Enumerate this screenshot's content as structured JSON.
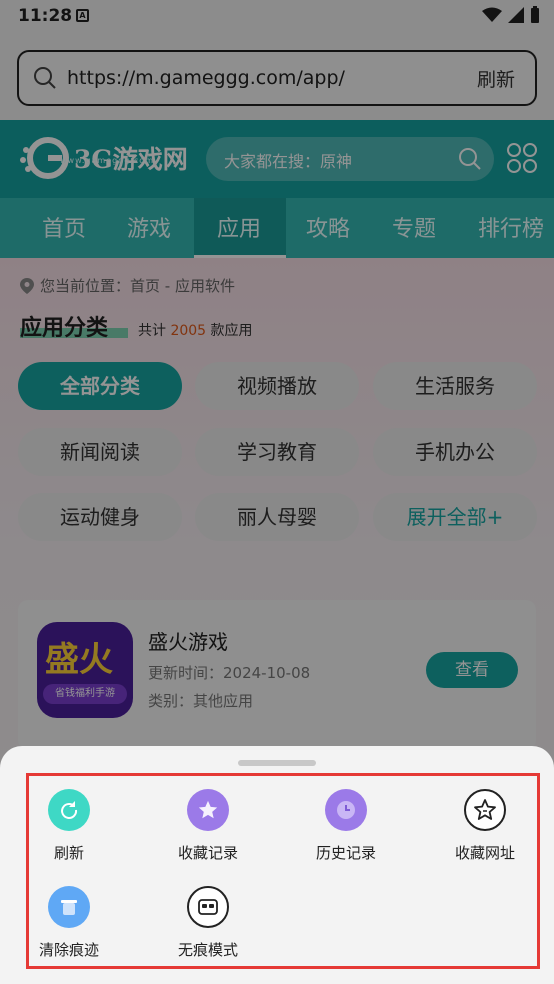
{
  "status_bar": {
    "time": "11:28",
    "notification_letter": "A"
  },
  "url_bar": {
    "url": "https://m.gameggg.com/app/",
    "refresh_label": "刷新"
  },
  "site_header": {
    "logo_text": "3G游戏网",
    "logo_subtext": "www.gameggg.com",
    "search_placeholder": "大家都在搜：原神"
  },
  "nav": {
    "tabs": [
      "首页",
      "游戏",
      "应用",
      "攻略",
      "专题",
      "排行榜"
    ],
    "active": "应用"
  },
  "breadcrumb": "您当前位置：首页 - 应用软件",
  "category": {
    "title": "应用分类",
    "count_prefix": "共计",
    "count": "2005",
    "count_suffix": "款应用",
    "chips": [
      "全部分类",
      "视频播放",
      "生活服务",
      "新闻阅读",
      "学习教育",
      "手机办公",
      "运动健身",
      "丽人母婴",
      "展开全部+"
    ]
  },
  "app_card": {
    "icon_text": "盛火",
    "icon_subtext": "省钱福利手游",
    "name": "盛火游戏",
    "update_time": "更新时间：2024-10-08",
    "category": "类别：其他应用",
    "view_label": "查看"
  },
  "sheet": {
    "actions": [
      {
        "label": "刷新",
        "icon": "refresh-icon",
        "color": "#3ed8c5"
      },
      {
        "label": "收藏记录",
        "icon": "star-icon",
        "color": "#9b7ae8"
      },
      {
        "label": "历史记录",
        "icon": "clock-icon",
        "color": "#9b7ae8"
      },
      {
        "label": "收藏网址",
        "icon": "star-outline-icon",
        "color": "#ffffff"
      },
      {
        "label": "清除痕迹",
        "icon": "trash-icon",
        "color": "#5fa8f5"
      },
      {
        "label": "无痕模式",
        "icon": "incognito-icon",
        "color": "#ffffff"
      }
    ]
  },
  "colors": {
    "accent": "#17a6a2",
    "highlight_frame": "#e53935",
    "count_number": "#e05a1a"
  }
}
